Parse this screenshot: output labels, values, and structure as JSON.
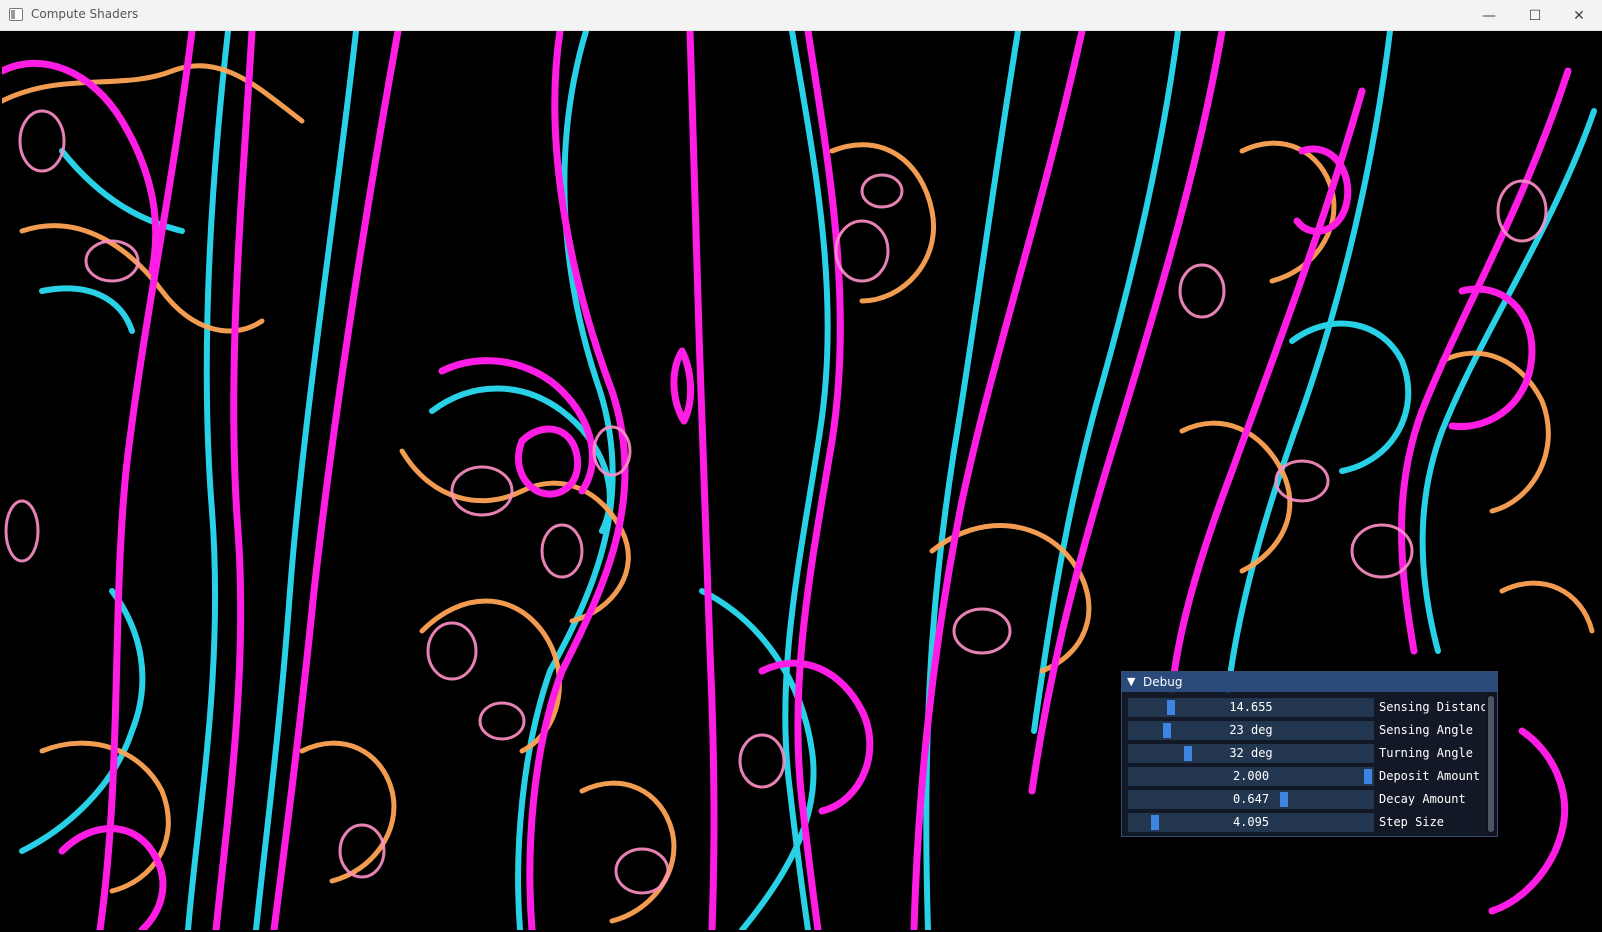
{
  "window": {
    "title": "Compute Shaders",
    "controls": {
      "minimize": "—",
      "maximize": "☐",
      "close": "✕"
    }
  },
  "canvas": {
    "content": "slime-mold-simulation",
    "colors": {
      "magenta": "#ff1de6",
      "cyan": "#2ee8ff",
      "orange": "#ffa455",
      "pink": "#ff8fc8",
      "background": "#000000"
    }
  },
  "debug_panel": {
    "title": "Debug",
    "collapse_icon": "▼",
    "accent": "#3d85e0",
    "params": [
      {
        "label": "Sensing Distanc",
        "value": "14.655",
        "fraction": 0.16
      },
      {
        "label": "Sensing Angle",
        "value": "23 deg",
        "fraction": 0.14
      },
      {
        "label": "Turning Angle",
        "value": "32 deg",
        "fraction": 0.23
      },
      {
        "label": "Deposit Amount",
        "value": "2.000",
        "fraction": 1.0
      },
      {
        "label": "Decay Amount",
        "value": "0.647",
        "fraction": 0.64
      },
      {
        "label": "Step Size",
        "value": "4.095",
        "fraction": 0.09
      }
    ]
  }
}
